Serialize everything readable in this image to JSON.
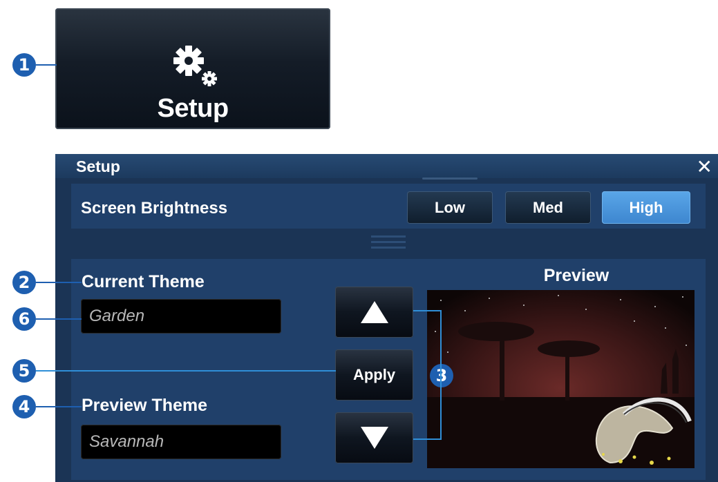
{
  "launcher": {
    "label": "Setup",
    "icon": "gears-icon"
  },
  "callouts": [
    "1",
    "2",
    "3",
    "4",
    "5",
    "6"
  ],
  "dialog": {
    "title": "Setup",
    "close_icon": "close-icon",
    "brightness": {
      "label": "Screen Brightness",
      "options": [
        "Low",
        "Med",
        "High"
      ],
      "selected": "High"
    },
    "current_theme": {
      "label": "Current Theme",
      "value": "Garden"
    },
    "preview_theme": {
      "label": "Preview Theme",
      "value": "Savannah"
    },
    "buttons": {
      "up_icon": "triangle-up-icon",
      "apply_label": "Apply",
      "down_icon": "triangle-down-icon"
    },
    "preview": {
      "title": "Preview"
    }
  },
  "colors": {
    "callout": "#1e5fb0",
    "dialog_bg": "#1b3455",
    "panel_bg": "#20406a",
    "active_button": "#4a96dc"
  }
}
